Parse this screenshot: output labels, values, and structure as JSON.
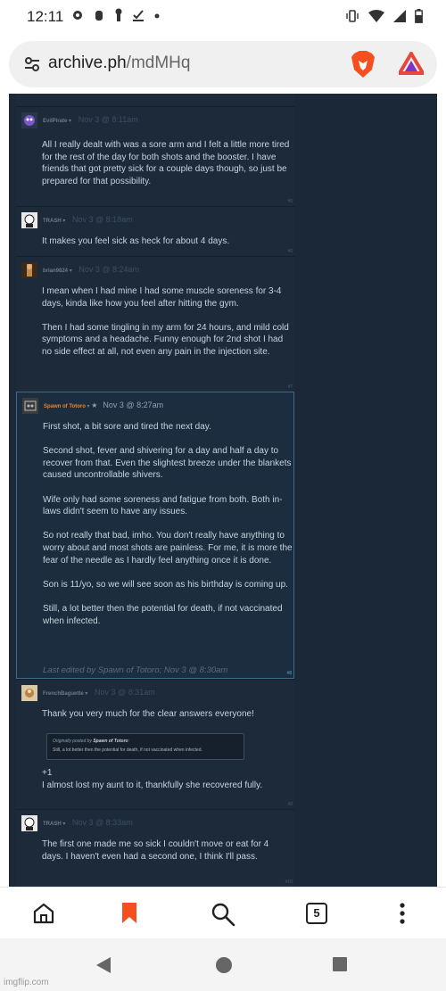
{
  "status": {
    "time": "12:11",
    "icons": [
      "gear-icon",
      "hand-icon",
      "keyhole-icon",
      "download-check-icon",
      "dot-icon",
      "vibrate-icon",
      "wifi-icon",
      "signal-icon",
      "battery-icon"
    ]
  },
  "browser": {
    "url_domain": "archive.ph",
    "url_path": "/mdMHq",
    "tab_count": "5",
    "accent": "#f54e1f"
  },
  "comments": [
    {
      "author": "EvilPirate",
      "date": "Nov 3 @ 8:11am",
      "paragraphs": [
        "All I really dealt with was a sore arm and I felt a little more tired for the rest of the day for both shots and the booster. I have friends that got pretty sick for a couple days though, so just be prepared for that possibility."
      ],
      "num": "#5"
    },
    {
      "author": "TRASH",
      "date": "Nov 3 @ 8:18am",
      "paragraphs": [
        "It makes you feel sick as heck for about 4 days."
      ],
      "num": "#6"
    },
    {
      "author": "brian9824",
      "date": "Nov 3 @ 8:24am",
      "paragraphs": [
        "I mean when I had mine I had some muscle soreness for 3-4 days, kinda like how you feel after hitting the gym.",
        "Then I had some tingling in my arm for 24 hours, and mild cold symptoms and a headache. Funny enough for 2nd shot I had no side effect at all, not even any pain in the injection site."
      ],
      "num": "#7"
    },
    {
      "author": "Spawn of Totoro",
      "date": "Nov 3 @ 8:27am",
      "paragraphs": [
        "First shot, a bit sore and tired the next day.",
        "Second shot, fever and shivering for a day and half a day to recover from that. Even the slightest breeze under the blankets caused uncontrollable shivers.",
        "Wife only had some soreness and fatigue from both. Both in-laws didn't seem to have any issues.",
        "So not really that bad, imho. You don't really have anything to worry about and most shots are painless. For me, it is more the fear of the needle as I hardly feel anything once it is done.",
        "Son is 11/yo, so we will see soon as his birthday is coming up.",
        "Still, a lot better then the potential for death, if not vaccinated when infected."
      ],
      "edited": "Last edited by Spawn of Totoro; Nov 3 @ 8:30am",
      "num": "#8"
    },
    {
      "author": "FrenchBaguette",
      "date": "Nov 3 @ 8:31am",
      "paragraphs": [
        "Thank you very much for the clear answers everyone!"
      ],
      "quote": {
        "prefix": "Originally posted by",
        "author": "Spawn of Totoro",
        "text": "Still, a lot better then the potential for death, if not vaccinated when infected."
      },
      "after_quote": [
        "+1",
        "I almost lost my aunt to it, thankfully she recovered fully."
      ],
      "num": "#9"
    },
    {
      "author": "TRASH",
      "date": "Nov 3 @ 8:33am",
      "paragraphs": [
        "The first one made me so sick I couldn't move or eat for 4 days. I haven't even had a second one, I think I'll pass."
      ],
      "num": "#10"
    }
  ],
  "watermark": "imgflip.com"
}
